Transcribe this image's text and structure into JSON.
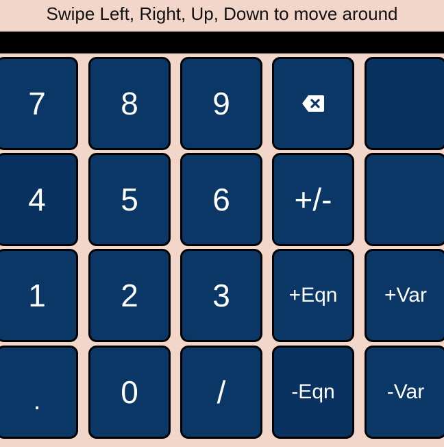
{
  "hint": {
    "text": "Swipe Left, Right, Up, Down to move around"
  },
  "display": {
    "value": ""
  },
  "keys": {
    "seven": "7",
    "eight": "8",
    "nine": "9",
    "backspace_icon": "backspace-icon",
    "four": "4",
    "five": "5",
    "six": "6",
    "sign": "+/-",
    "one": "1",
    "two": "2",
    "three": "3",
    "add_eqn": "+Eqn",
    "add_var": "+Var",
    "dot": ".",
    "zero": "0",
    "slash": "/",
    "remove_eqn": "-Eqn",
    "remove_var": "-Var"
  },
  "colors": {
    "background": "#f2d6ca",
    "key": "#0b3766",
    "key_text": "#ffffff",
    "display": "#000000"
  }
}
